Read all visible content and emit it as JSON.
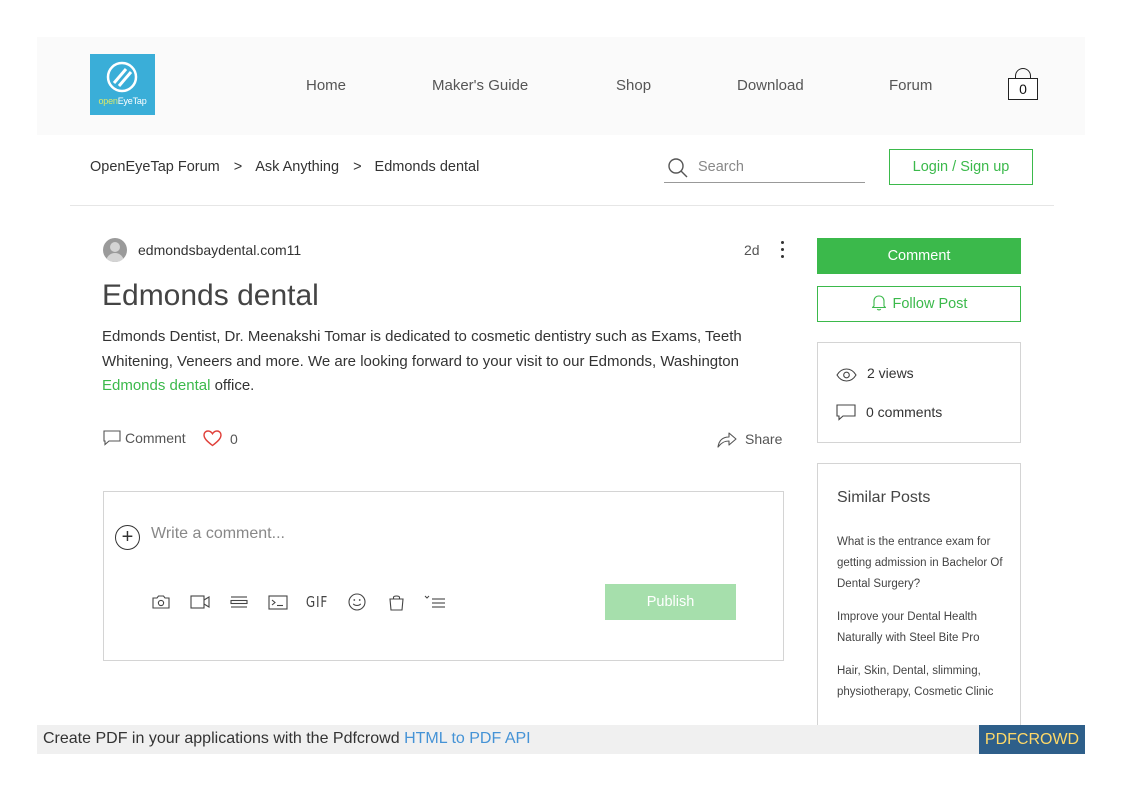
{
  "header": {
    "logo_text_open": "open",
    "logo_text_rest": "EyeTap",
    "nav": [
      {
        "label": "Home"
      },
      {
        "label": "Maker's Guide"
      },
      {
        "label": "Shop"
      },
      {
        "label": "Download"
      },
      {
        "label": "Forum"
      }
    ],
    "cart_count": "0"
  },
  "breadcrumb": {
    "items": [
      "OpenEyeTap Forum",
      "Ask Anything",
      "Edmonds dental"
    ],
    "separator": ">"
  },
  "search": {
    "placeholder": "Search",
    "value": ""
  },
  "login_label": "Login / Sign up",
  "post": {
    "author": "edmondsbaydental.com11",
    "age": "2d",
    "title": "Edmonds dental",
    "body_before_link": "Edmonds Dentist, Dr. Meenakshi Tomar is dedicated to cosmetic dentistry such as Exams, Teeth Whitening, Veneers and more. We are looking forward to your visit to our Edmonds, Washington ",
    "body_link": "Edmonds dental",
    "body_after_link": " office.",
    "comment_label": "Comment",
    "likes": "0",
    "share_label": "Share"
  },
  "composer": {
    "placeholder": "Write a comment...",
    "gif_label": "GIF",
    "publish_label": "Publish",
    "toolbar_icons": [
      "camera-icon",
      "video-icon",
      "divider-icon",
      "code-icon",
      "gif-icon",
      "emoji-icon",
      "bag-icon",
      "list-icon"
    ]
  },
  "sidebar": {
    "comment_label": "Comment",
    "follow_label": "Follow Post",
    "views": "2 views",
    "comments": "0 comments",
    "similar_title": "Similar Posts",
    "similar_posts": [
      "What is the entrance exam for getting admission in Bachelor Of Dental Surgery?",
      "Improve your Dental Health Naturally with Steel Bite Pro",
      "Hair, Skin, Dental, slimming, physiotherapy, Cosmetic Clinic"
    ]
  },
  "pdfbar": {
    "text": "Create PDF in your applications with the Pdfcrowd ",
    "link": "HTML to PDF API",
    "brand": "PDFCROWD"
  },
  "colors": {
    "accent_green": "#3bb94b",
    "publish_disabled": "#a6dfac",
    "logo_blue": "#3aaed8",
    "like_red": "#e0403a",
    "pdf_brand_bg": "#2e5f8a",
    "pdf_brand_fg": "#ffd968"
  }
}
